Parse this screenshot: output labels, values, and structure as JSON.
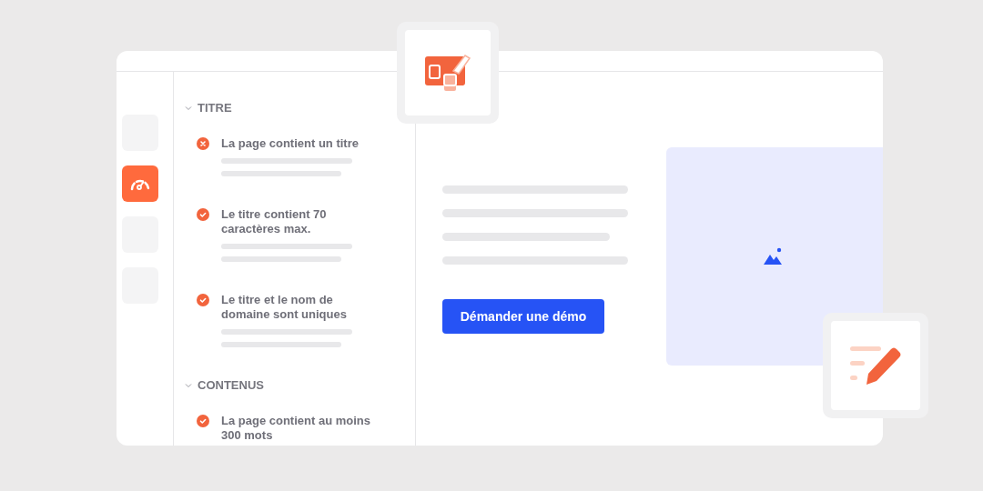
{
  "rail": [
    {
      "selected": false
    },
    {
      "selected": true
    },
    {
      "selected": false
    },
    {
      "selected": false
    }
  ],
  "sections": [
    {
      "title": "TITRE",
      "expanded": true,
      "items": [
        {
          "label": "La page contient un titre",
          "passed": false
        },
        {
          "label": "Le titre contient 70 caractères max.",
          "passed": true
        },
        {
          "label": "Le titre et le nom de domaine sont uniques",
          "passed": true
        }
      ]
    },
    {
      "title": "CONTENUS",
      "expanded": true,
      "items": [
        {
          "label": "La page contient au moins 300 mots",
          "passed": true
        }
      ]
    }
  ],
  "cta": {
    "label": "Démander une démo"
  }
}
